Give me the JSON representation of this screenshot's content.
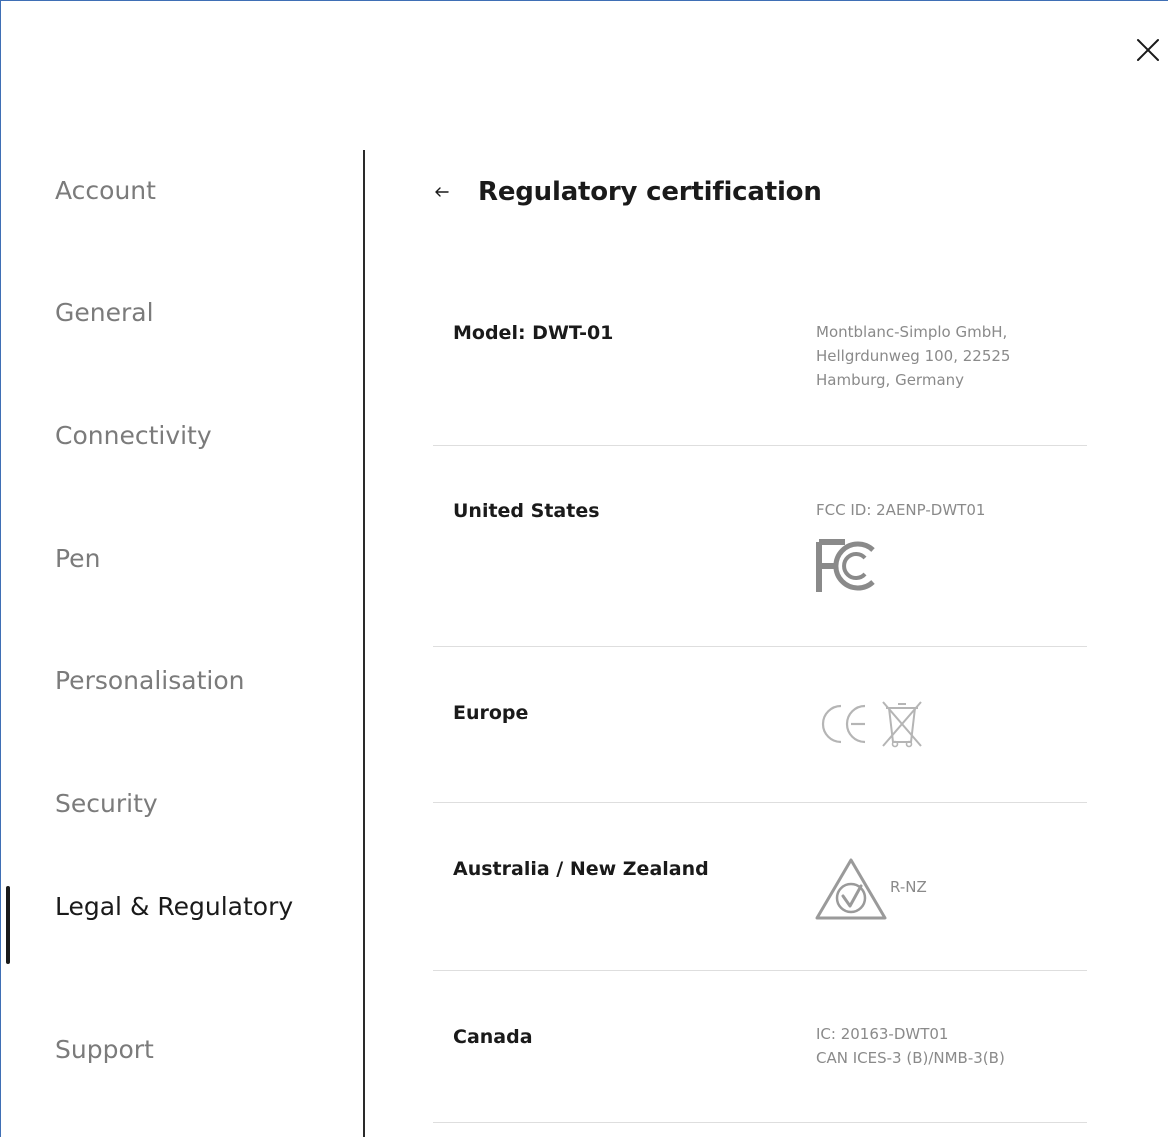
{
  "window": {
    "close_icon": "close-icon"
  },
  "sidebar": {
    "items": [
      {
        "label": "Account"
      },
      {
        "label": "General"
      },
      {
        "label": "Connectivity"
      },
      {
        "label": "Pen"
      },
      {
        "label": "Personalisation"
      },
      {
        "label": "Security"
      },
      {
        "label": "Legal & Regulatory",
        "active": true
      },
      {
        "label": "Support"
      }
    ]
  },
  "header": {
    "back_icon": "back-arrow-icon",
    "title": "Regulatory certification"
  },
  "rows": {
    "model": {
      "label": "Model: DWT-01",
      "address": [
        "Montblanc-Simplo GmbH,",
        "Hellgrdunweg 100, 22525",
        "Hamburg, Germany"
      ]
    },
    "us": {
      "label": "United States",
      "value": "FCC ID: 2AENP-DWT01",
      "mark_icon": "fcc-logo-icon"
    },
    "europe": {
      "label": "Europe",
      "mark_icons": [
        "ce-mark-icon",
        "weee-crossed-bin-icon"
      ]
    },
    "anz": {
      "label": "Australia / New Zealand",
      "mark_icon": "rcm-mark-icon",
      "mark_text": "R-NZ"
    },
    "canada": {
      "label": "Canada",
      "lines": [
        "IC: 20163-DWT01",
        "CAN ICES-3 (B)/NMB-3(B)"
      ]
    }
  },
  "colors": {
    "accent_border": "#3f6fb5",
    "text_dark": "#1a1a1a",
    "text_muted": "#8a8a8a",
    "separator": "#dedede"
  }
}
